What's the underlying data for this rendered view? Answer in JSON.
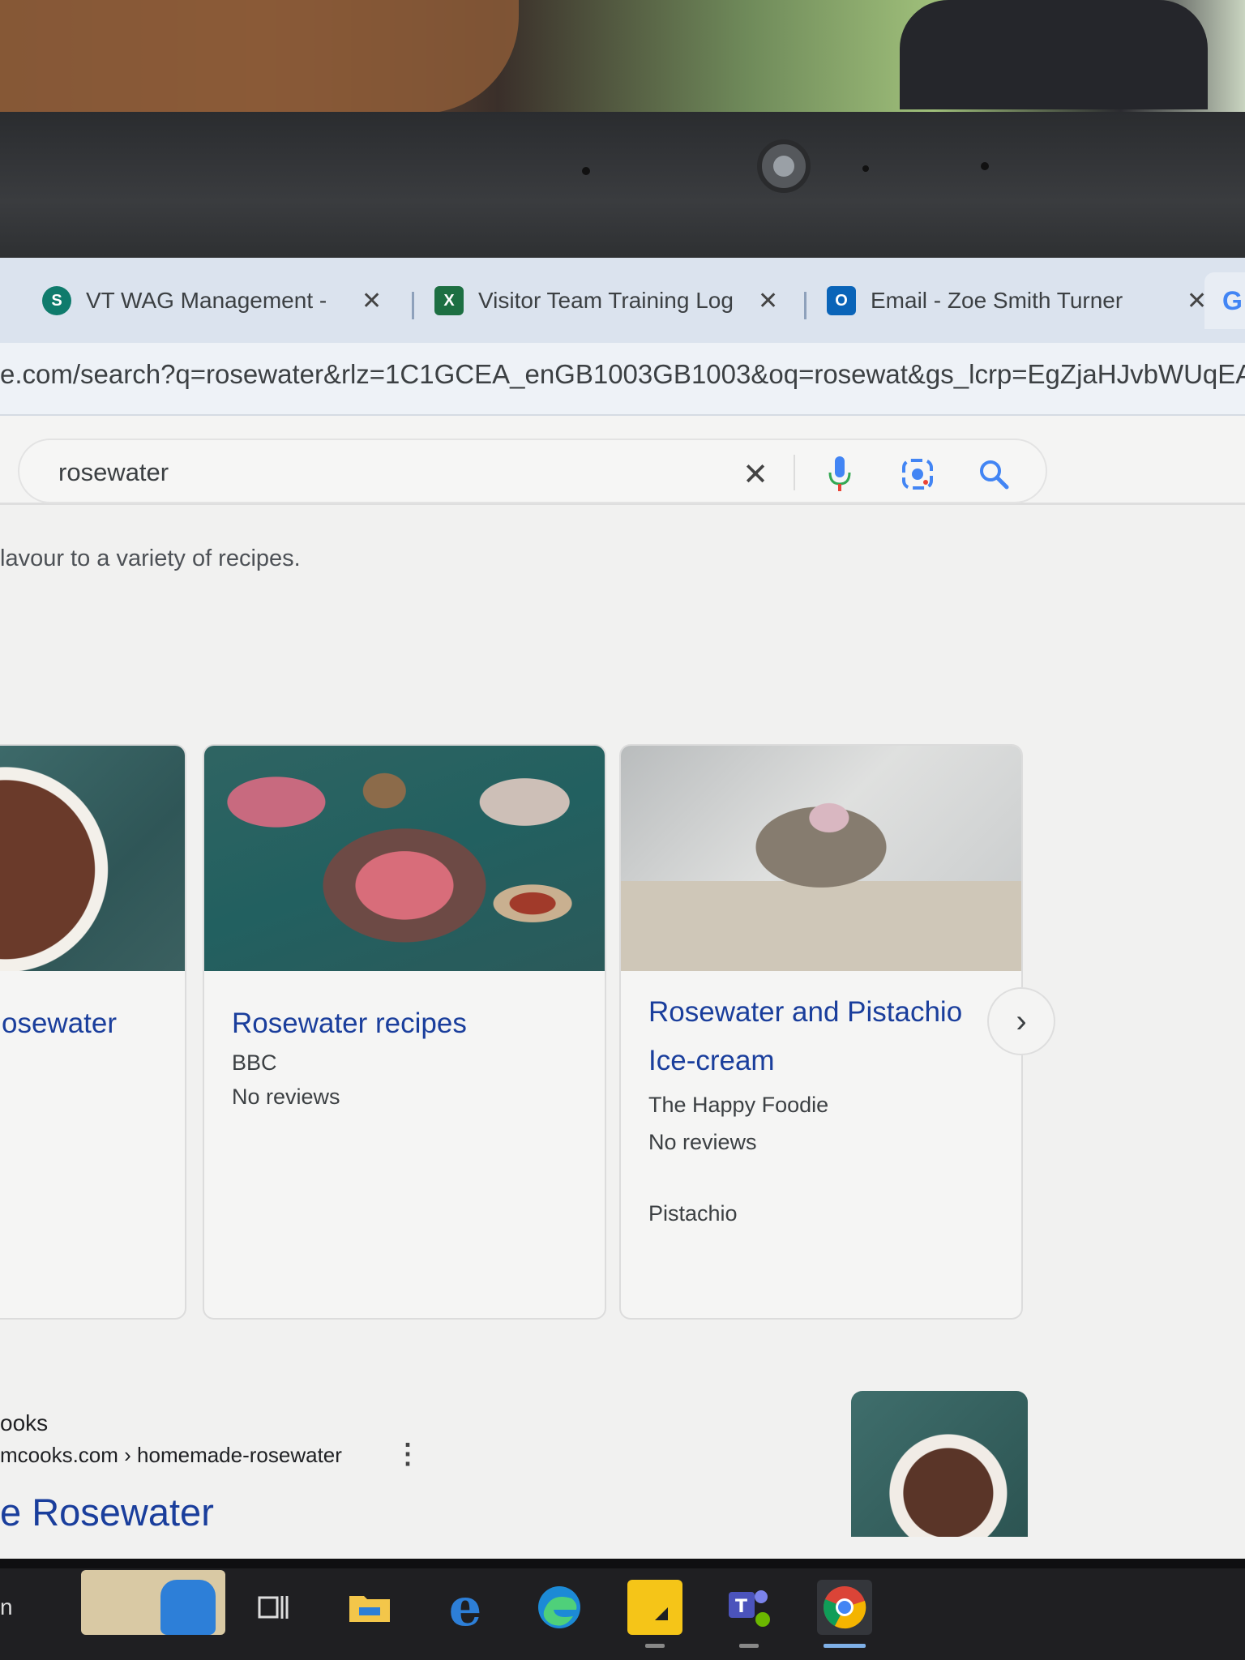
{
  "tabs": [
    {
      "title": "VT WAG Management - ",
      "icon": "sharepoint-icon",
      "color": "#0f7b6c"
    },
    {
      "title": "Visitor Team Training Log",
      "icon": "excel-icon",
      "color": "#1d6f42"
    },
    {
      "title": "Email - Zoe Smith Turner",
      "icon": "outlook-icon",
      "color": "#0a64b8"
    },
    {
      "title": "G",
      "icon": "google-icon",
      "color": "#4285f4"
    }
  ],
  "address_bar": {
    "url": "e.com/search?q=rosewater&rlz=1C1GCEA_enGB1003GB1003&oq=rosewat&gs_lcrp=EgZjaHJvbWUqEAgA"
  },
  "search": {
    "query": "rosewater",
    "icons": [
      "clear-icon",
      "microphone-icon",
      "lens-icon",
      "search-icon"
    ]
  },
  "snippet": "lavour to a variety of recipes.",
  "recipe_cards": [
    {
      "title": "osewater",
      "source": "",
      "reviews": "",
      "tag": ""
    },
    {
      "title": "Rosewater recipes",
      "source": "BBC",
      "reviews": "No reviews",
      "tag": ""
    },
    {
      "title_line1": "Rosewater and Pistachio",
      "title_line2": "Ice-cream",
      "source": "The Happy Foodie",
      "reviews": "No reviews",
      "tag": "Pistachio"
    }
  ],
  "next_button": "›",
  "result": {
    "site_name": "ooks",
    "breadcrumb": "mcooks.com › homemade-rosewater",
    "title": "e Rosewater",
    "menu": "⋮"
  },
  "taskbar": {
    "left_label": "n",
    "apps": [
      "notepad-icon",
      "teams-blue-icon",
      "task-view-icon",
      "file-explorer-icon",
      "internet-explorer-icon",
      "edge-icon",
      "sticky-notes-icon",
      "teams-icon",
      "chrome-icon"
    ]
  },
  "colors": {
    "link": "#1a3e9c",
    "tabstrip": "#dbe3ee"
  }
}
